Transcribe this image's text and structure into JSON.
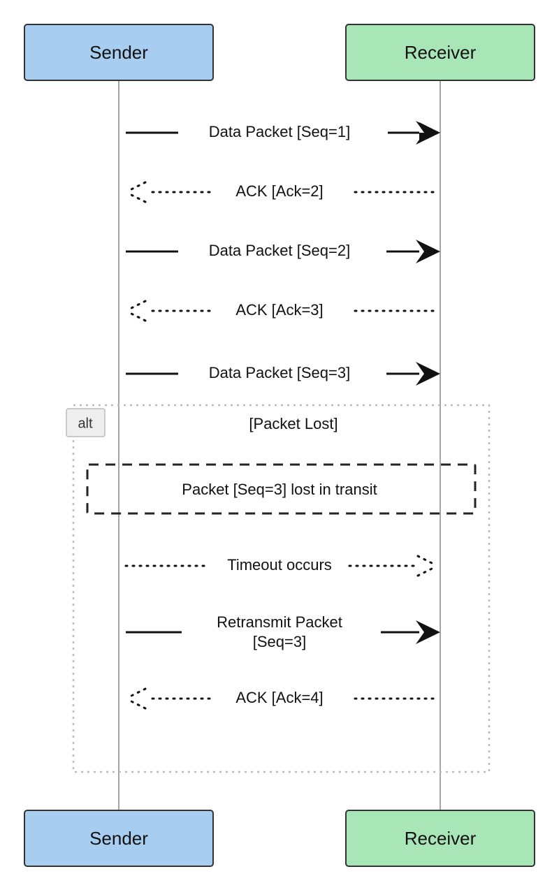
{
  "actors": {
    "sender": "Sender",
    "receiver": "Receiver"
  },
  "messages": {
    "m1": "Data Packet [Seq=1]",
    "m2": "ACK [Ack=2]",
    "m3": "Data Packet [Seq=2]",
    "m4": "ACK [Ack=3]",
    "m5": "Data Packet [Seq=3]",
    "alt_title": "[Packet Lost]",
    "note": "Packet [Seq=3] lost in transit",
    "m6": "Timeout occurs",
    "m7_line1": "Retransmit Packet",
    "m7_line2": "[Seq=3]",
    "m8": "ACK [Ack=4]"
  },
  "alt_tag": "alt"
}
